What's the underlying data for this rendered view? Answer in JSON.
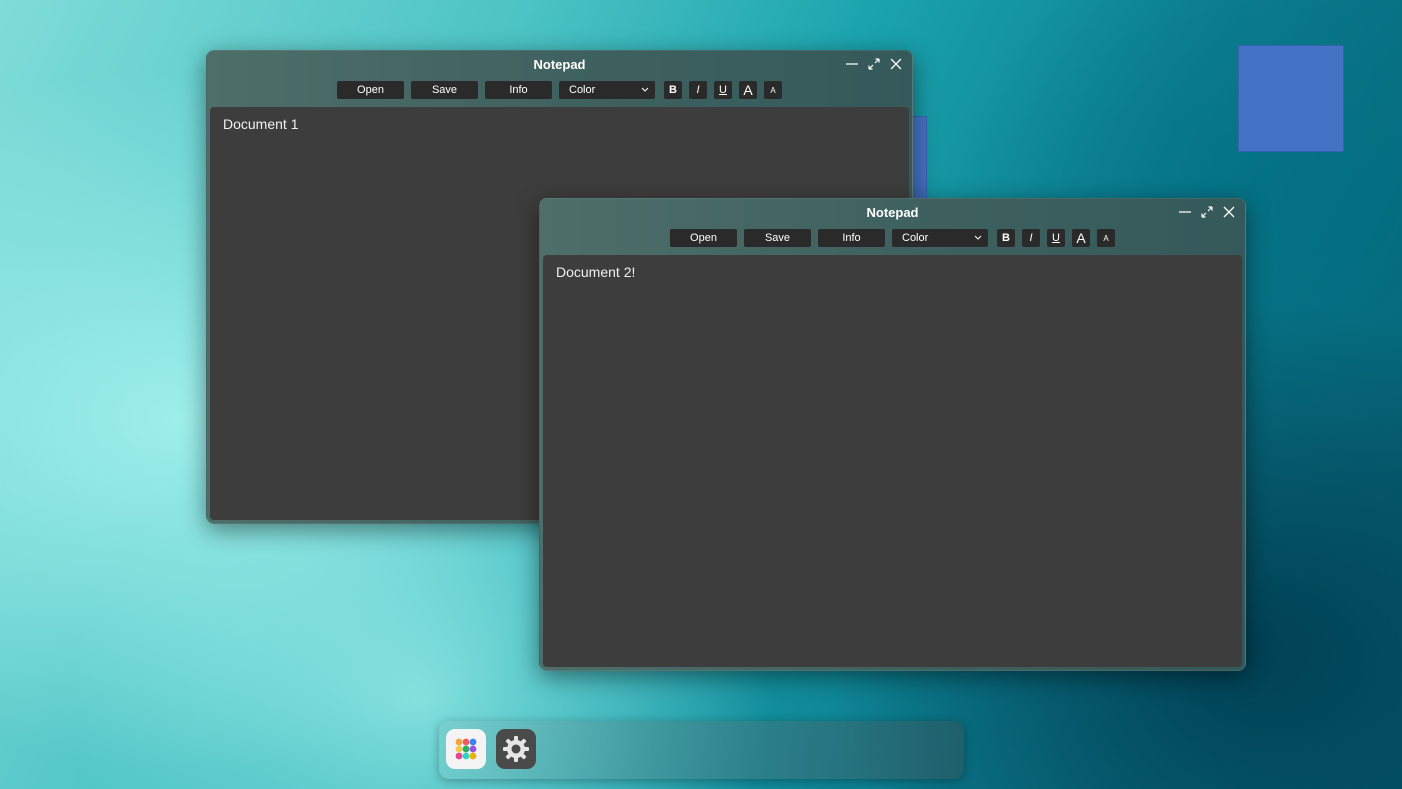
{
  "desktop": {
    "square_color": "#4472c4"
  },
  "window1": {
    "title": "Notepad",
    "toolbar": {
      "open": "Open",
      "save": "Save",
      "info": "Info",
      "color": "Color",
      "bold": "B",
      "italic": "I",
      "underline": "U",
      "font_bigger": "A",
      "font_smaller": "A"
    },
    "content": "Document 1"
  },
  "window2": {
    "title": "Notepad",
    "toolbar": {
      "open": "Open",
      "save": "Save",
      "info": "Info",
      "color": "Color",
      "bold": "B",
      "italic": "I",
      "underline": "U",
      "font_bigger": "A",
      "font_smaller": "A"
    },
    "content": "Document 2!"
  },
  "dock": {
    "apps": [
      "app-grid-icon",
      "settings-gear-icon"
    ]
  }
}
